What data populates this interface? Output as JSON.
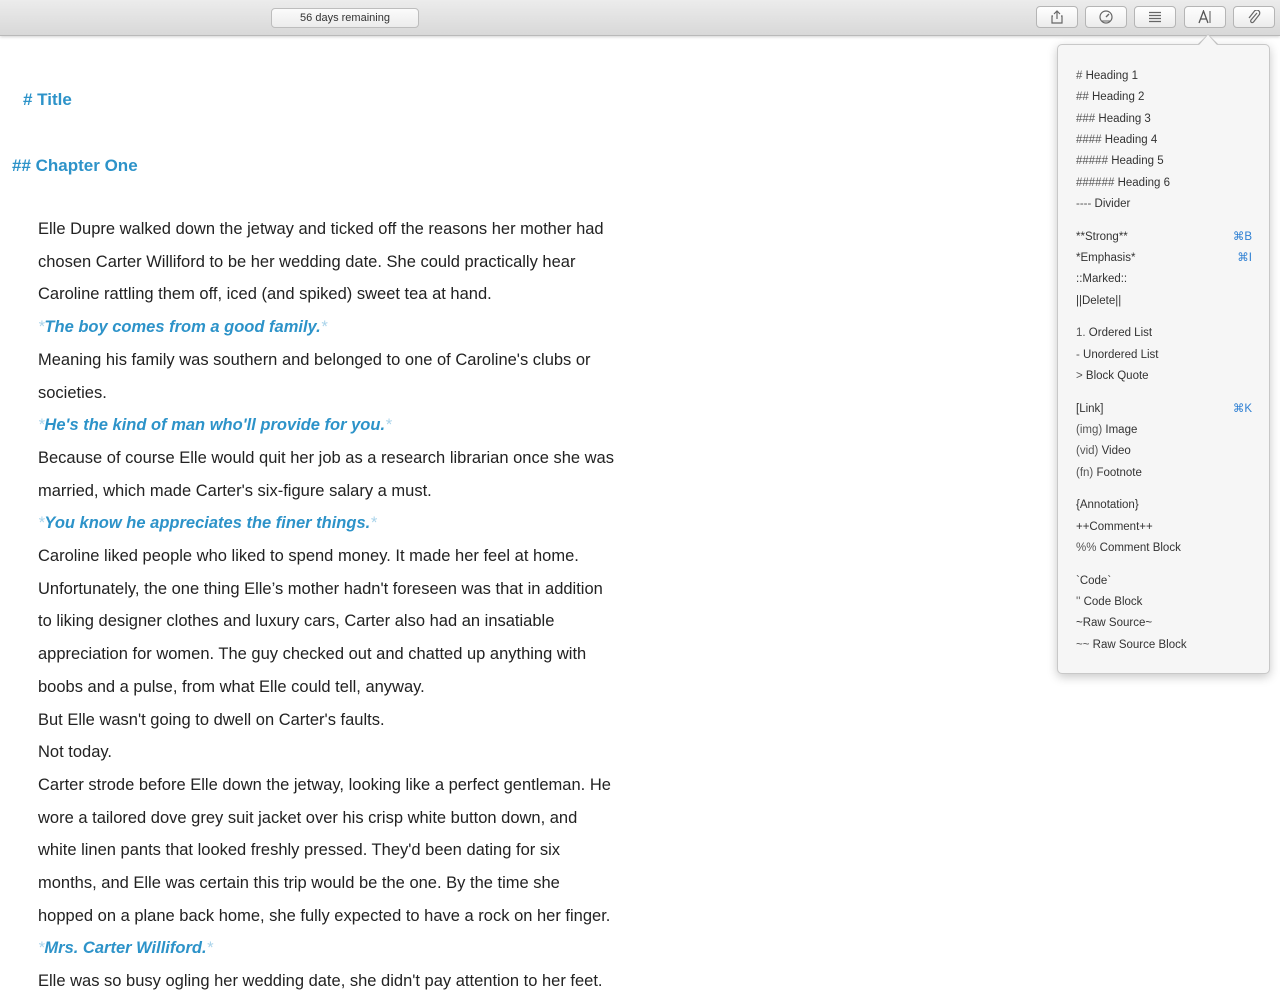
{
  "toolbar": {
    "trial_text": "56 days remaining",
    "buttons": [
      {
        "name": "share-icon"
      },
      {
        "name": "gauge-icon"
      },
      {
        "name": "list-icon"
      },
      {
        "name": "text-format-icon"
      },
      {
        "name": "paperclip-icon"
      }
    ]
  },
  "document": {
    "title": "# Title",
    "chapter": "## Chapter One",
    "emphasis_marker": "*",
    "paragraphs": [
      {
        "text": "Elle Dupre walked down the jetway and ticked off the reasons her mother had"
      },
      {
        "text": "chosen Carter Williford to be her wedding date. She could practically hear"
      },
      {
        "text": "Caroline rattling them off, iced (and spiked) sweet tea at hand."
      },
      {
        "emphasis": "The boy comes from a good family."
      },
      {
        "text": "Meaning his family was southern and belonged to one of Caroline's clubs or"
      },
      {
        "text": "societies."
      },
      {
        "emphasis": "He's the kind of man who'll provide for you."
      },
      {
        "text": "Because of course Elle would quit her job as a research librarian once she was"
      },
      {
        "text": "married, which made Carter's six-figure salary a must."
      },
      {
        "emphasis": "You know he appreciates the finer things."
      },
      {
        "text": "Caroline liked people who liked to spend money. It made her feel at home."
      },
      {
        "text": "Unfortunately, the one thing Elle’s mother hadn't foreseen was that in addition"
      },
      {
        "text": "to liking designer clothes and luxury cars, Carter also had an insatiable"
      },
      {
        "text": "appreciation for women. The guy checked out and chatted up anything with"
      },
      {
        "text": "boobs and a pulse, from what Elle could tell, anyway."
      },
      {
        "text": "But Elle wasn't going to dwell on Carter's faults."
      },
      {
        "text": "Not today."
      },
      {
        "text": "Carter strode before Elle down the jetway, looking like a perfect gentleman. He"
      },
      {
        "text": "wore a tailored dove grey suit jacket over his crisp white button down, and"
      },
      {
        "text": "white linen pants that looked freshly pressed. They'd been dating for six"
      },
      {
        "text": "months, and Elle was certain this trip would be the one. By the time she"
      },
      {
        "text": "hopped on a plane back home, she fully expected to have a rock on her finger."
      },
      {
        "emphasis": "Mrs. Carter Williford."
      },
      {
        "text": "Elle was so busy ogling her wedding date, she didn't pay attention to her feet."
      }
    ]
  },
  "format_menu": {
    "items": [
      {
        "prefix": "#",
        "label": "Heading 1",
        "shortcut": ""
      },
      {
        "prefix": "##",
        "label": "Heading 2",
        "shortcut": ""
      },
      {
        "prefix": "###",
        "label": "Heading 3",
        "shortcut": ""
      },
      {
        "prefix": "####",
        "label": "Heading 4",
        "shortcut": ""
      },
      {
        "prefix": "#####",
        "label": "Heading 5",
        "shortcut": ""
      },
      {
        "prefix": "######",
        "label": "Heading 6",
        "shortcut": ""
      },
      {
        "prefix": "----",
        "label": "Divider",
        "shortcut": ""
      },
      {
        "prefix": "",
        "label": "**Strong**",
        "shortcut": "⌘B"
      },
      {
        "prefix": "",
        "label": "*Emphasis*",
        "shortcut": "⌘I"
      },
      {
        "prefix": "",
        "label": "::Marked::",
        "shortcut": ""
      },
      {
        "prefix": "",
        "label": "||Delete||",
        "shortcut": ""
      },
      {
        "prefix": "1.",
        "label": "Ordered List",
        "shortcut": ""
      },
      {
        "prefix": "-",
        "label": "Unordered List",
        "shortcut": ""
      },
      {
        "prefix": ">",
        "label": "Block Quote",
        "shortcut": ""
      },
      {
        "prefix": "",
        "label": "[Link]",
        "shortcut": "⌘K"
      },
      {
        "prefix": "(img)",
        "label": "Image",
        "shortcut": ""
      },
      {
        "prefix": "(vid)",
        "label": "Video",
        "shortcut": ""
      },
      {
        "prefix": "(fn)",
        "label": "Footnote",
        "shortcut": ""
      },
      {
        "prefix": "",
        "label": "{Annotation}",
        "shortcut": ""
      },
      {
        "prefix": "",
        "label": "++Comment++",
        "shortcut": ""
      },
      {
        "prefix": "%%",
        "label": "Comment Block",
        "shortcut": ""
      },
      {
        "prefix": "",
        "label": "`Code`",
        "shortcut": ""
      },
      {
        "prefix": "''",
        "label": "Code Block",
        "shortcut": ""
      },
      {
        "prefix": "",
        "label": "~Raw Source~",
        "shortcut": ""
      },
      {
        "prefix": "~~",
        "label": "Raw Source Block",
        "shortcut": ""
      }
    ]
  },
  "colors": {
    "accent": "#2d93c9",
    "shortcut": "#2d7fd3"
  }
}
